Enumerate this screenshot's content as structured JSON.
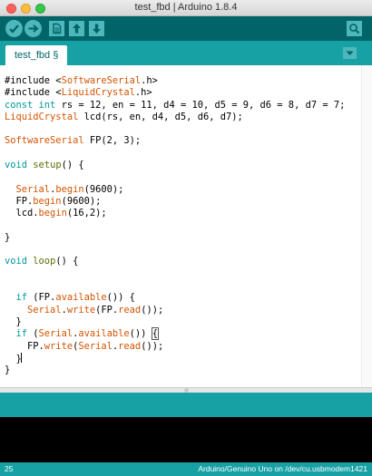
{
  "window": {
    "title": "test_fbd | Arduino 1.8.4"
  },
  "toolbar": {
    "buttons": [
      {
        "name": "verify",
        "icon": "checkmark-icon"
      },
      {
        "name": "upload",
        "icon": "arrow-right-icon"
      },
      {
        "name": "new",
        "icon": "new-file-icon"
      },
      {
        "name": "open",
        "icon": "arrow-up-icon"
      },
      {
        "name": "save",
        "icon": "arrow-down-icon"
      },
      {
        "name": "serial-monitor",
        "icon": "magnifier-icon"
      }
    ]
  },
  "tabs": [
    {
      "label": "test_fbd §",
      "active": true
    }
  ],
  "editor": {
    "lines": [
      [
        {
          "t": "#include <"
        },
        {
          "t": "SoftwareSerial",
          "c": "kw1"
        },
        {
          "t": ".h>"
        }
      ],
      [
        {
          "t": "#include <"
        },
        {
          "t": "LiquidCrystal",
          "c": "kw1"
        },
        {
          "t": ".h>"
        }
      ],
      [
        {
          "t": "const",
          "c": "kw2"
        },
        {
          "t": " "
        },
        {
          "t": "int",
          "c": "kw2"
        },
        {
          "t": " rs = 12, en = 11, d4 = 10, d5 = 9, d6 = 8, d7 = 7;"
        }
      ],
      [
        {
          "t": "LiquidCrystal",
          "c": "kw1"
        },
        {
          "t": " lcd(rs, en, d4, d5, d6, d7);"
        }
      ],
      [],
      [
        {
          "t": "SoftwareSerial",
          "c": "kw1"
        },
        {
          "t": " FP(2, 3);"
        }
      ],
      [],
      [
        {
          "t": "void",
          "c": "kw2"
        },
        {
          "t": " "
        },
        {
          "t": "setup",
          "c": "kw3"
        },
        {
          "t": "() {"
        }
      ],
      [],
      [
        {
          "t": "  "
        },
        {
          "t": "Serial",
          "c": "kw1"
        },
        {
          "t": "."
        },
        {
          "t": "begin",
          "c": "kw1"
        },
        {
          "t": "(9600);"
        }
      ],
      [
        {
          "t": "  FP."
        },
        {
          "t": "begin",
          "c": "kw1"
        },
        {
          "t": "(9600);"
        }
      ],
      [
        {
          "t": "  lcd."
        },
        {
          "t": "begin",
          "c": "kw1"
        },
        {
          "t": "(16,2);"
        }
      ],
      [],
      [
        {
          "t": "}"
        }
      ],
      [],
      [
        {
          "t": "void",
          "c": "kw2"
        },
        {
          "t": " "
        },
        {
          "t": "loop",
          "c": "kw3"
        },
        {
          "t": "() {"
        }
      ],
      [],
      [],
      [
        {
          "t": "  "
        },
        {
          "t": "if",
          "c": "kw2"
        },
        {
          "t": " (FP."
        },
        {
          "t": "available",
          "c": "kw1"
        },
        {
          "t": "()) {"
        }
      ],
      [
        {
          "t": "    "
        },
        {
          "t": "Serial",
          "c": "kw1"
        },
        {
          "t": "."
        },
        {
          "t": "write",
          "c": "kw1"
        },
        {
          "t": "(FP."
        },
        {
          "t": "read",
          "c": "kw1"
        },
        {
          "t": "());"
        }
      ],
      [
        {
          "t": "  }"
        }
      ],
      [
        {
          "t": "  "
        },
        {
          "t": "if",
          "c": "kw2"
        },
        {
          "t": " ("
        },
        {
          "t": "Serial",
          "c": "kw1"
        },
        {
          "t": "."
        },
        {
          "t": "available",
          "c": "kw1"
        },
        {
          "t": "()) "
        },
        {
          "t": "{",
          "c": "bracket-hl"
        }
      ],
      [
        {
          "t": "    FP."
        },
        {
          "t": "write",
          "c": "kw1"
        },
        {
          "t": "("
        },
        {
          "t": "Serial",
          "c": "kw1"
        },
        {
          "t": "."
        },
        {
          "t": "read",
          "c": "kw1"
        },
        {
          "t": "());"
        }
      ],
      [
        {
          "t": "  }"
        },
        {
          "caret": true
        }
      ],
      [
        {
          "t": "}"
        }
      ]
    ]
  },
  "status": {
    "line_number": "25",
    "board": "Arduino/Genuino Uno on /dev/cu.usbmodem1421"
  },
  "colors": {
    "toolbar": "#006468",
    "tabbar": "#17a1a5",
    "button": "#4db7bb",
    "keyword_orange": "#d35400",
    "keyword_teal": "#00979c",
    "keyword_olive": "#5e6d03"
  }
}
